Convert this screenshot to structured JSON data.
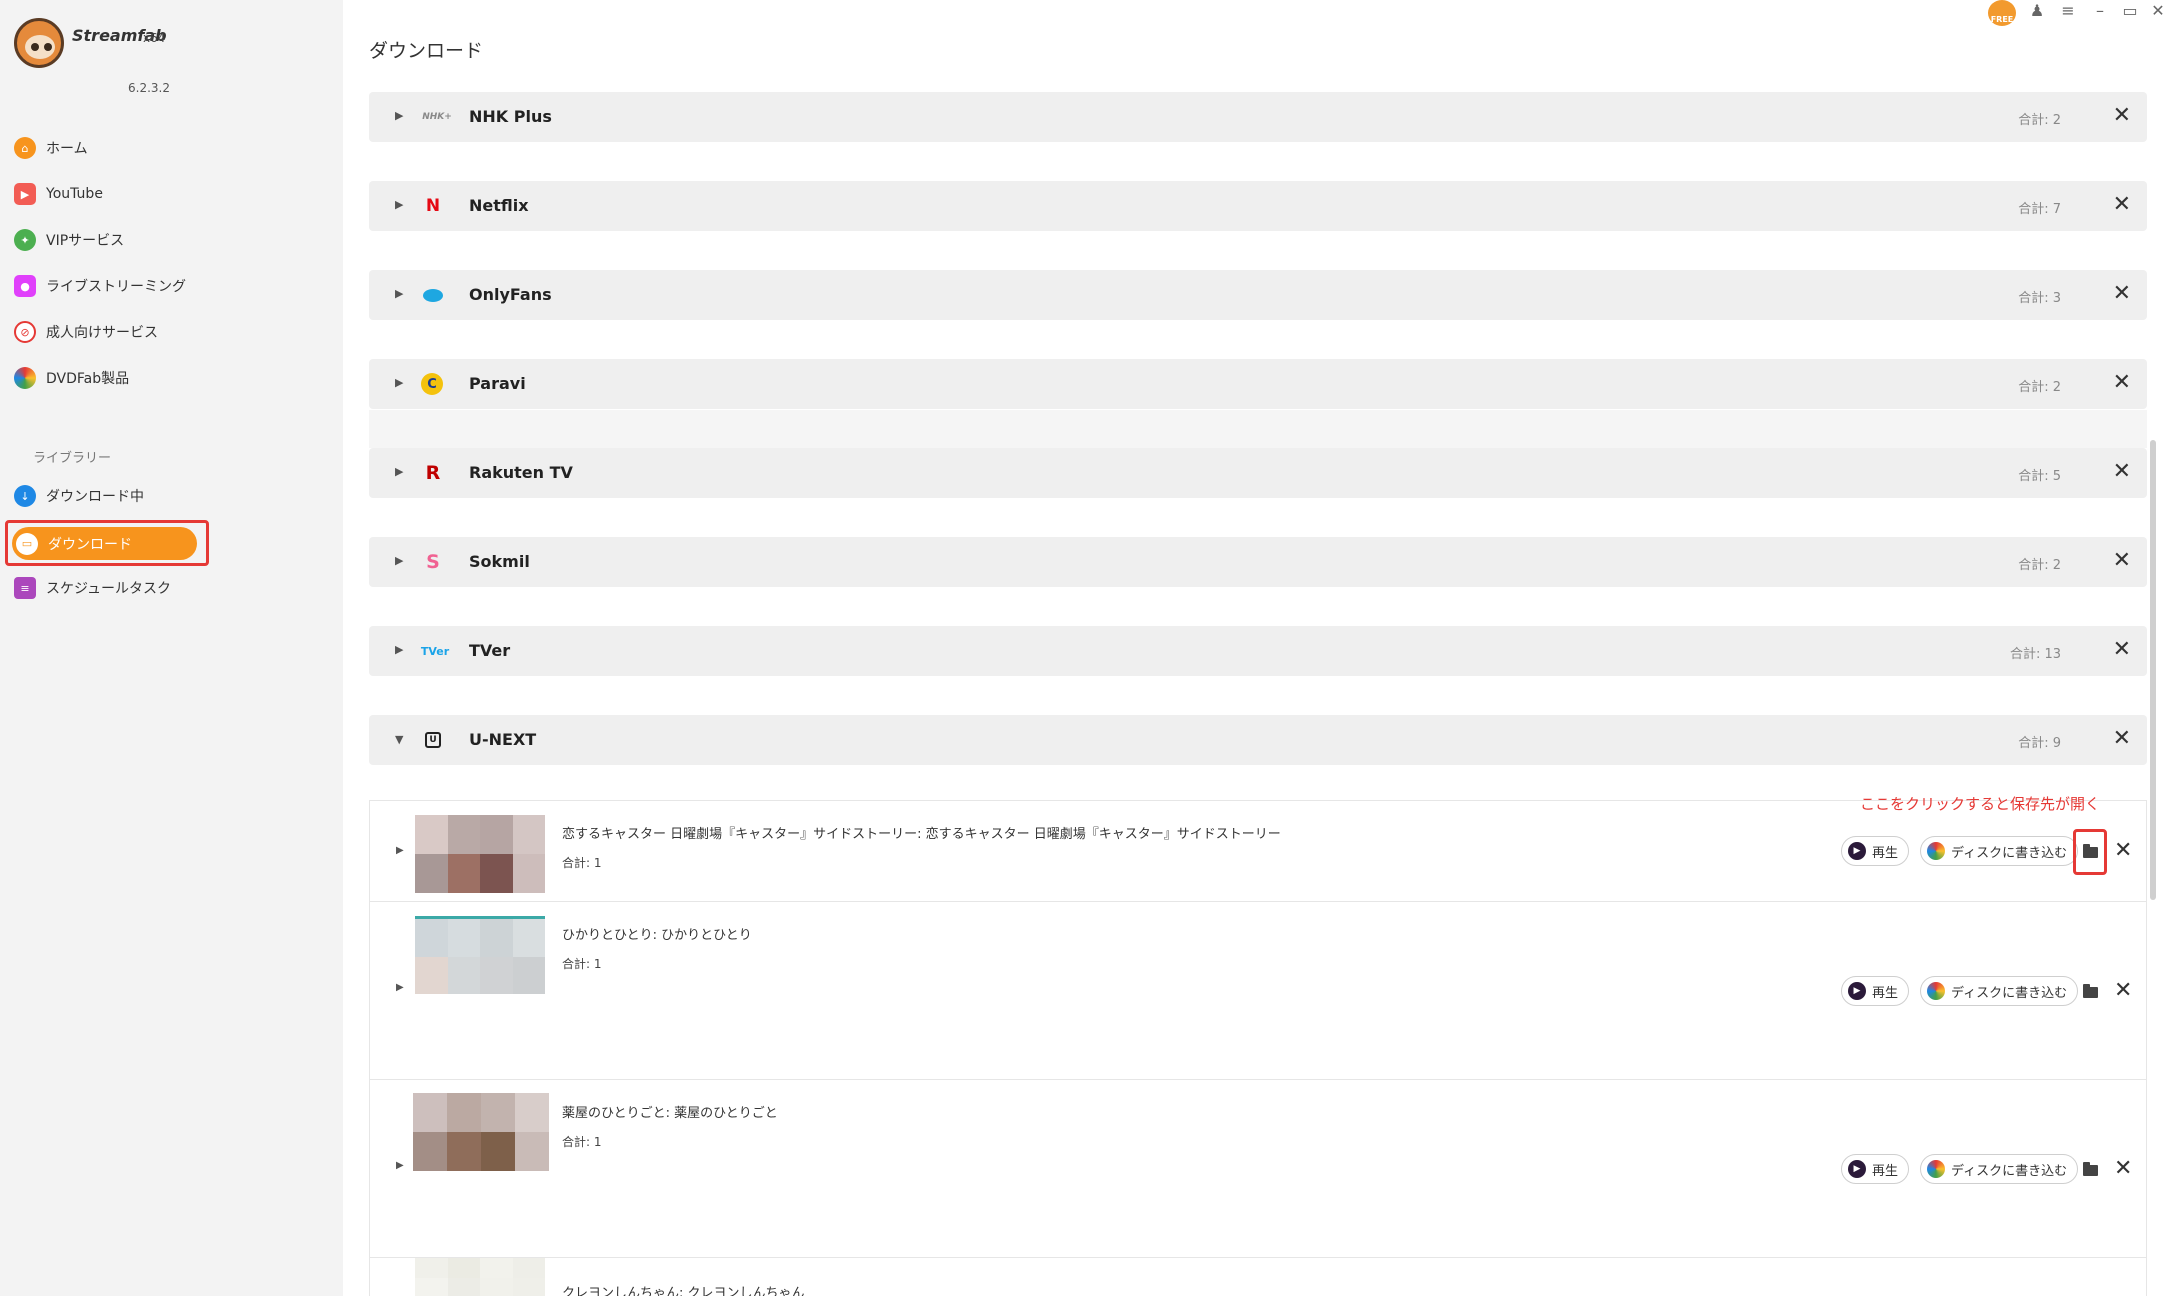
{
  "app": {
    "name": "Streamfab",
    "arch": "x64",
    "version": "6.2.3.2"
  },
  "titlebar": {
    "badge": "FREE"
  },
  "nav": {
    "items": [
      {
        "label": "ホーム",
        "icon": "home-icon",
        "color": "#f7941d"
      },
      {
        "label": "YouTube",
        "icon": "youtube-icon",
        "color": "#f25c54"
      },
      {
        "label": "VIPサービス",
        "icon": "key-icon",
        "color": "#4caf50"
      },
      {
        "label": "ライブストリーミング",
        "icon": "camera-icon",
        "color": "#e040fb"
      },
      {
        "label": "成人向けサービス",
        "icon": "no-adult-icon",
        "color": "#e53935"
      },
      {
        "label": "DVDFab製品",
        "icon": "dvdfab-icon",
        "color": "#3f51b5"
      }
    ],
    "library_label": "ライブラリー",
    "library": [
      {
        "label": "ダウンロード中",
        "icon": "download-icon",
        "color": "#1e88e5"
      },
      {
        "label": "ダウンロード",
        "icon": "folder-icon",
        "active": true,
        "color": "#f7941d"
      },
      {
        "label": "スケジュールタスク",
        "icon": "schedule-icon",
        "color": "#ab47bc"
      }
    ]
  },
  "page": {
    "title": "ダウンロード"
  },
  "groups": [
    {
      "name": "NHK Plus",
      "count": "合計: 2",
      "icon": "nhk-plus-icon",
      "icon_text": "NHK+"
    },
    {
      "name": "Netflix",
      "count": "合計: 7",
      "icon": "netflix-icon",
      "icon_text": "N"
    },
    {
      "name": "OnlyFans",
      "count": "合計: 3",
      "icon": "onlyfans-icon",
      "icon_text": ""
    },
    {
      "name": "Paravi",
      "count": "合計: 2",
      "icon": "paravi-icon",
      "icon_text": "C"
    },
    {
      "name": "Rakuten TV",
      "count": "合計: 5",
      "icon": "rakuten-icon",
      "icon_text": "R"
    },
    {
      "name": "Sokmil",
      "count": "合計: 2",
      "icon": "sokmil-icon",
      "icon_text": "S"
    },
    {
      "name": "TVer",
      "count": "合計: 13",
      "icon": "tver-icon",
      "icon_text": "TVer"
    },
    {
      "name": "U-NEXT",
      "count": "合計: 9",
      "icon": "unext-icon",
      "icon_text": "U"
    }
  ],
  "hint": "ここをクリックすると保存先が開く",
  "items": [
    {
      "title": "恋するキャスター 日曜劇場『キャスター』サイドストーリー: 恋するキャスター 日曜劇場『キャスター』サイドストーリー",
      "count": "合計: 1"
    },
    {
      "title": "ひかりとひとり: ひかりとひとり",
      "count": "合計: 1"
    },
    {
      "title": "薬屋のひとりごと: 薬屋のひとりごと",
      "count": "合計: 1"
    },
    {
      "title": "クレヨンしんちゃん: クレヨンしんちゃん",
      "count": ""
    }
  ],
  "actions": {
    "play": "再生",
    "burn": "ディスクに書き込む"
  }
}
